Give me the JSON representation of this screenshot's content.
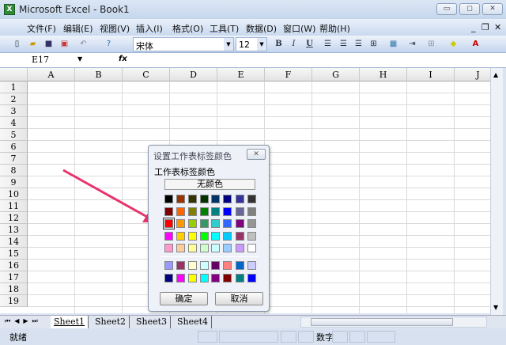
{
  "window": {
    "title": "Microsoft Excel - Book1",
    "controls": [
      "minimize",
      "restore",
      "close"
    ]
  },
  "menu": [
    "文件(F)",
    "编辑(E)",
    "视图(V)",
    "插入(I)",
    "格式(O)",
    "工具(T)",
    "数据(D)",
    "窗口(W)",
    "帮助(H)"
  ],
  "toolbar": {
    "font": "宋体",
    "size": "12",
    "bold": "B",
    "italic": "I",
    "underline": "U"
  },
  "formula": {
    "namebox": "E17",
    "fx": "fx",
    "value": ""
  },
  "columns": [
    "A",
    "B",
    "C",
    "D",
    "E",
    "F",
    "G",
    "H",
    "I",
    "J"
  ],
  "rows": [
    "1",
    "2",
    "3",
    "4",
    "5",
    "6",
    "7",
    "8",
    "9",
    "10",
    "11",
    "12",
    "13",
    "14",
    "15",
    "16",
    "17",
    "18",
    "19"
  ],
  "sheets": [
    "Sheet1",
    "Sheet2",
    "Sheet3",
    "Sheet4"
  ],
  "active_sheet": "Sheet1",
  "status": {
    "left": "就绪",
    "num": "数字"
  },
  "dialog": {
    "title": "设置工作表标签颜色",
    "label": "工作表标签颜色",
    "no_color": "无颜色",
    "ok": "确定",
    "cancel": "取消",
    "selected": "#FF0000",
    "palette": [
      [
        "#000000",
        "#993300",
        "#333300",
        "#003300",
        "#003366",
        "#000080",
        "#333399",
        "#333333"
      ],
      [
        "#800000",
        "#FF6600",
        "#808000",
        "#008000",
        "#008080",
        "#0000FF",
        "#666699",
        "#808080"
      ],
      [
        "#FF0000",
        "#FF9900",
        "#99CC00",
        "#339966",
        "#33CCCC",
        "#3366FF",
        "#800080",
        "#969696"
      ],
      [
        "#FF00FF",
        "#FFCC00",
        "#FFFF00",
        "#00FF00",
        "#00FFFF",
        "#00CCFF",
        "#993366",
        "#C0C0C0"
      ],
      [
        "#FF99CC",
        "#FFCC99",
        "#FFFF99",
        "#CCFFCC",
        "#CCFFFF",
        "#99CCFF",
        "#CC99FF",
        "#FFFFFF"
      ]
    ],
    "chart_colors": [
      [
        "#9999FF",
        "#993366",
        "#FFFFCC",
        "#CCFFFF",
        "#660066",
        "#FF8080",
        "#0066CC",
        "#CCCCFF"
      ],
      [
        "#000080",
        "#FF00FF",
        "#FFFF00",
        "#00FFFF",
        "#800080",
        "#800000",
        "#008080",
        "#0000FF"
      ]
    ]
  },
  "annotation": {
    "arrow_color": "#E8336B"
  }
}
